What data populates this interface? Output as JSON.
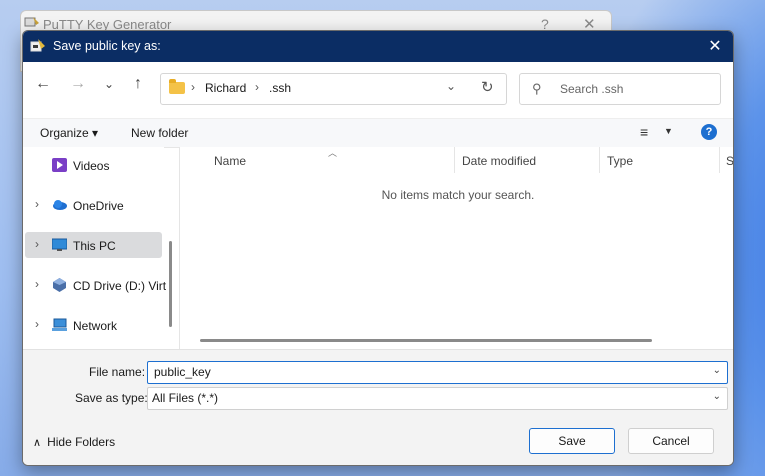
{
  "background_window": {
    "title": "PuTTY Key Generator",
    "help": "?",
    "close": "✕"
  },
  "dialog": {
    "title": "Save public key as:",
    "close": "✕"
  },
  "nav_buttons": {
    "back": "←",
    "forward": "→",
    "recent": "⌄",
    "up": "↑"
  },
  "address": {
    "crumbs": [
      "Richard",
      ".ssh"
    ],
    "sep": "›",
    "dropdown": "⌄",
    "refresh": "↻"
  },
  "search": {
    "icon": "⚲",
    "placeholder": "Search .ssh"
  },
  "toolbar": {
    "organize": "Organize ▾",
    "new_folder": "New folder",
    "view": "≡",
    "view_caret": "▼",
    "help": "?"
  },
  "sidebar": {
    "items": [
      {
        "label": "Videos",
        "chev": "",
        "icon": "videos-icon"
      },
      {
        "label": "OneDrive",
        "chev": "›",
        "icon": "onedrive-icon"
      },
      {
        "label": "This PC",
        "chev": "›",
        "icon": "this-pc-icon"
      },
      {
        "label": "CD Drive (D:) Virt",
        "chev": "›",
        "icon": "cd-drive-icon"
      },
      {
        "label": "Network",
        "chev": "›",
        "icon": "network-icon"
      }
    ]
  },
  "columns": [
    "Name",
    "Date modified",
    "Type",
    "Si"
  ],
  "sort_arrow": "︿",
  "empty_message": "No items match your search.",
  "form": {
    "file_name_label": "File name:",
    "file_name_value": "public_key",
    "save_type_label": "Save as type:",
    "save_type_value": "All Files (*.*)",
    "caret": "⌄"
  },
  "footer": {
    "hide_folders": "Hide Folders",
    "hide_icon": "∧",
    "save": "Save",
    "cancel": "Cancel"
  },
  "colors": {
    "titlebar": "#0b2d64",
    "accent": "#1d6fd0",
    "folder": "#f4c247"
  }
}
